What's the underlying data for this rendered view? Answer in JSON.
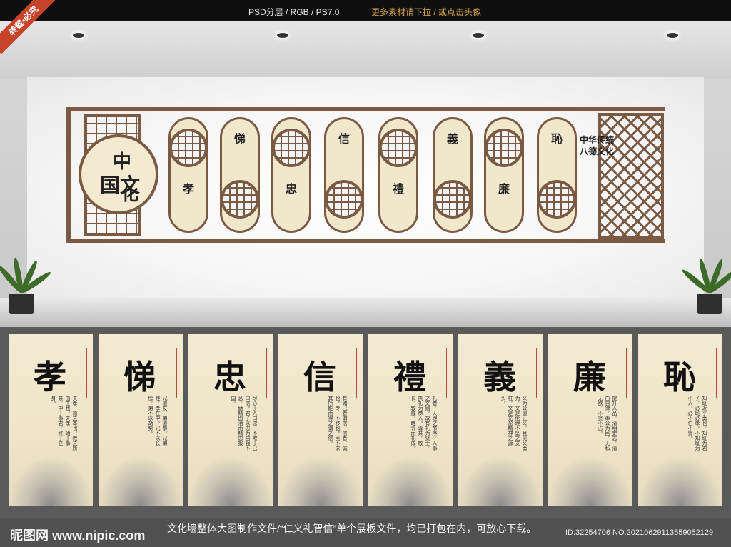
{
  "topbar": {
    "format": "PSD分层 / RGB / PS7.0",
    "more": "更多素材请下拉 / 或点击头像",
    "ribbon": "转载•必究"
  },
  "wall": {
    "plaque": {
      "c1": "中",
      "c2": "国文",
      "c3": "化"
    },
    "right_text": "中华传统 八德文化",
    "chars": [
      "孝",
      "悌",
      "忠",
      "信",
      "禮",
      "義",
      "廉",
      "恥"
    ]
  },
  "panels": [
    {
      "char": "孝",
      "text": "夫孝，德之本也。教之所由生也。夫孝，始于事亲，中于事君，终于立身。"
    },
    {
      "char": "悌",
      "text": "兄道友，弟道恭。兄弟睦，孝在中。兄不以长傍，弟不以劫势。"
    },
    {
      "char": "忠",
      "text": "尽心于人曰忠，不欺于己曰信。君子以忠为自强不息，励精图治而精忠报国。"
    },
    {
      "char": "信",
      "text": "有诸己者谓信，信者，诚也。专一不移也。民不求其所能而得之谓之信。"
    },
    {
      "char": "禮",
      "text": "礼者，天理之节序，人事之文则。故有礼为贤士，执礼为恭人。尊亲，敬长，敦威，睦邻而礼成。"
    },
    {
      "char": "義",
      "text": "义为公道正义，且见义勇为，文是伦理不坠之支柱，文是充盈精神之源头。"
    },
    {
      "char": "廉",
      "text": "提升人品，清明吏志，清白自律，奉公为民，无私无欲，不贪不占。"
    },
    {
      "char": "恥",
      "text": "知耻近乎勇也，知耻为君子，必恥必孝。不知耻为小人，必不仁不贤。"
    }
  ],
  "footer": {
    "logo": "昵图网 www.nipic.com",
    "description": "文化墙整体大图制作文件/“仁义礼智信”单个展板文件，均已打包在内，可放心下载。",
    "id": "ID:32254706 NO:20210629113559052129"
  }
}
